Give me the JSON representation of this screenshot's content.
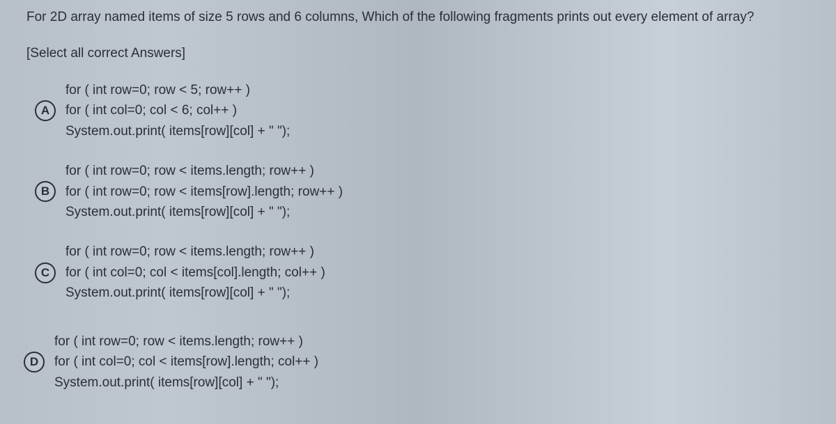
{
  "question": {
    "text": "For 2D array named items of size 5 rows and 6 columns, Which of the following fragments prints out every element of array?",
    "instruction": "[Select all correct Answers]"
  },
  "options": [
    {
      "letter": "A",
      "lines": [
        "for ( int row=0; row < 5; row++ )",
        "for ( int col=0; col < 6; col++ )",
        "System.out.print( items[row][col] + \" \");"
      ]
    },
    {
      "letter": "B",
      "lines": [
        "for ( int row=0; row < items.length; row++ )",
        "for ( int row=0; row < items[row].length; row++ )",
        "System.out.print( items[row][col] + \" \");"
      ]
    },
    {
      "letter": "C",
      "lines": [
        "for ( int row=0; row < items.length; row++ )",
        "for ( int col=0; col < items[col].length; col++ )",
        "System.out.print( items[row][col] + \" \");"
      ]
    },
    {
      "letter": "D",
      "lines": [
        "for ( int row=0; row < items.length; row++ )",
        "for ( int col=0; col < items[row].length; col++ )",
        "System.out.print( items[row][col] + \" \");"
      ]
    }
  ]
}
